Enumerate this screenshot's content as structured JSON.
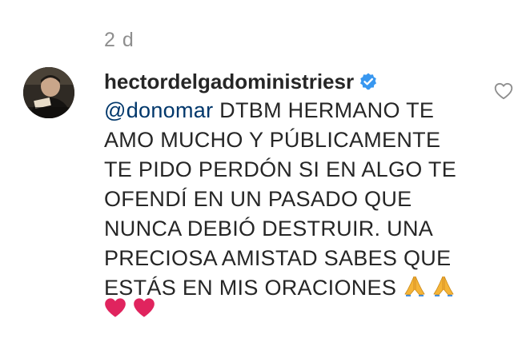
{
  "comment": {
    "timestamp": "2 d",
    "username": "hectordelgadoministriesr",
    "verified": true,
    "mention": "@donomar",
    "text_lines": [
      " DTBM HERMANO TE",
      "AMO MUCHO Y PÚBLICAMENTE",
      "TE PIDO PERDÓN SI EN ALGO TE",
      "OFENDÍ EN UN PASADO QUE",
      "NUNCA DEBIÓ DESTRUIR. UNA",
      "PRECIOSA AMISTAD SABES QUE",
      "ESTÁS EN MIS ORACIONES "
    ],
    "inline_emojis": [
      "folded-hands-emoji",
      "folded-hands-emoji"
    ],
    "trailing_emojis": [
      "red-heart-emoji",
      "red-heart-emoji"
    ]
  },
  "icons": {
    "verified_badge": "verified-badge-icon",
    "like": "heart-outline-icon"
  },
  "colors": {
    "text": "#262626",
    "muted": "#8e8e8e",
    "mention": "#00376b",
    "verified": "#3897f0",
    "heart": "#e0245e"
  }
}
